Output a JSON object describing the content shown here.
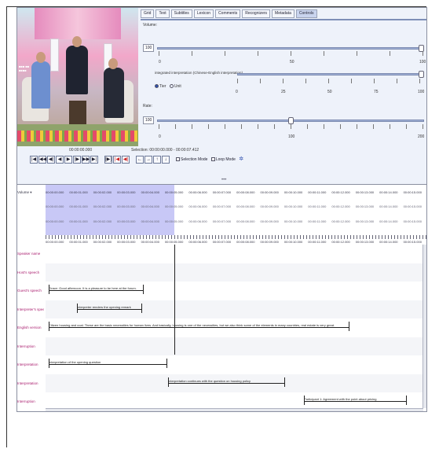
{
  "tabs": [
    "Grid",
    "Text",
    "Subtitles",
    "Lexicon",
    "Comments",
    "Recognizers",
    "Metadata",
    "Controls"
  ],
  "active_tab": 7,
  "controls": {
    "volume_label": "Volume:",
    "volume_value": "100",
    "volume_ticks": [
      "0",
      "50",
      "100"
    ],
    "volume_level": 1.0,
    "tier_volume_label": "integrated interpretation (Chinese-English interpretation)",
    "radio_on": "Tier",
    "radio_off": "Unit",
    "tier_ticks": [
      "0",
      "25",
      "50",
      "75",
      "100"
    ],
    "tier_level": 1.0,
    "rate_label": "Rate:",
    "rate_value": "100",
    "rate_ticks": [
      "0",
      "100",
      "200"
    ],
    "rate_level": 0.5
  },
  "transport": {
    "time_label": "00:00:00.000",
    "selection_label": "Selection: 00:00:00.000 - 00:00:07.412",
    "selection_mode": "Selection Mode",
    "loop_mode": "Loop Mode",
    "buttons_group1": [
      "|◀",
      "◀◀",
      "◀|",
      "◀",
      "▶",
      "|▶",
      "▶▶",
      "▶|"
    ],
    "buttons_group2": [
      "[▶]",
      "|◀",
      "◀|"
    ],
    "buttons_group3": [
      "←",
      "→",
      "↑",
      "↓"
    ]
  },
  "timeline": {
    "mode_label": "Volume ▾",
    "times": [
      "00:00:00.000",
      "00:00:01.000",
      "00:00:02.000",
      "00:00:03.000",
      "00:00:04.000",
      "00:00:05.000",
      "00:00:06.000",
      "00:00:07.000",
      "00:00:08.000",
      "00:00:09.000",
      "00:00:10.000",
      "00:00:11.000",
      "00:00:12.000",
      "00:00:13.000",
      "00:00:14.000",
      "00:00:15.000"
    ],
    "tiers": [
      {
        "name": "Speaker name"
      },
      {
        "name": "Host's speech"
      },
      {
        "name": "Guest's speech"
      },
      {
        "name": "Interpreter's speech"
      },
      {
        "name": "English version"
      },
      {
        "name": "Interruption"
      },
      {
        "name": "Interpretation"
      },
      {
        "name": "Interpretation"
      },
      {
        "name": "Interruption"
      }
    ],
    "segments": [
      {
        "tier": 2,
        "text": "Grace: Good afternoon. It is a pleasure to be here at the forum."
      },
      {
        "tier": 3,
        "text": "Interpreter renders the opening remark"
      },
      {
        "tier": 4,
        "text": "Citizen housing and coal. These are the basic necessities for human lives. And basically, housing is one of the necessities, but we also think some of the elements in many countries, real estate is very great."
      },
      {
        "tier": 6,
        "text": "Interpretation of the opening question"
      },
      {
        "tier": 7,
        "text": "Interpretation continues with the question on housing policy"
      },
      {
        "tier": 8,
        "text": "Participant 1: Agreement with the point about pricing"
      }
    ]
  }
}
